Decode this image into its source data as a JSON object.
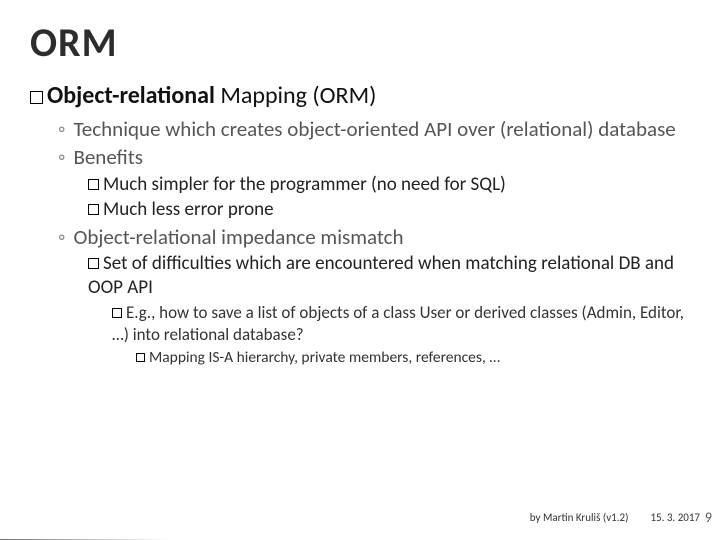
{
  "title": "ORM",
  "h1_prefix": "Object-relational",
  "h1_rest": " Mapping (ORM)",
  "l2_technique": "Technique which creates object-oriented API over (relational) database",
  "l2_benefits": "Benefits",
  "l3_benefit1": "Much simpler for the programmer (no need for SQL)",
  "l3_benefit2": "Much less error prone",
  "l2_mismatch": "Object-relational impedance mismatch",
  "l3_mismatch_desc": "Set of difficulties which are encountered when matching relational DB and OOP API",
  "l4_example": "E.g., how to save a list of objects of a class User or derived classes (Admin, Editor, …) into relational database?",
  "l5_mapping": "Mapping IS-A hierarchy, private members, references, …",
  "footer_author": "by Martin Kruliš (v1.2)",
  "footer_date": "15. 3. 2017",
  "page_number": "9"
}
